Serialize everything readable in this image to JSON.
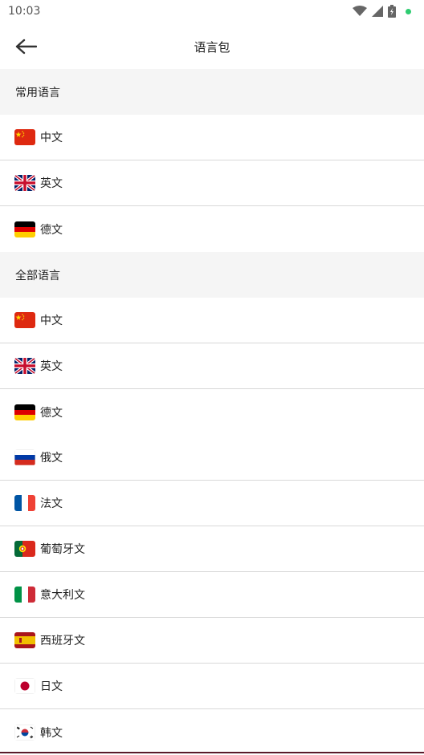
{
  "status": {
    "time": "10:03"
  },
  "header": {
    "title": "语言包"
  },
  "common_section": {
    "title": "常用语言",
    "items": [
      {
        "label": "中文",
        "flag": "china-flag-icon"
      },
      {
        "label": "英文",
        "flag": "uk-flag-icon"
      },
      {
        "label": "德文",
        "flag": "germany-flag-icon"
      }
    ]
  },
  "all_section": {
    "title": "全部语言",
    "items": [
      {
        "label": "中文",
        "flag": "china-flag-icon"
      },
      {
        "label": "英文",
        "flag": "uk-flag-icon"
      },
      {
        "label": "德文",
        "flag": "germany-flag-icon"
      },
      {
        "label": "俄文",
        "flag": "russia-flag-icon"
      },
      {
        "label": "法文",
        "flag": "france-flag-icon"
      },
      {
        "label": "葡萄牙文",
        "flag": "portugal-flag-icon"
      },
      {
        "label": "意大利文",
        "flag": "italy-flag-icon"
      },
      {
        "label": "西班牙文",
        "flag": "spain-flag-icon"
      },
      {
        "label": "日文",
        "flag": "japan-flag-icon"
      },
      {
        "label": "韩文",
        "flag": "korea-flag-icon"
      }
    ]
  }
}
